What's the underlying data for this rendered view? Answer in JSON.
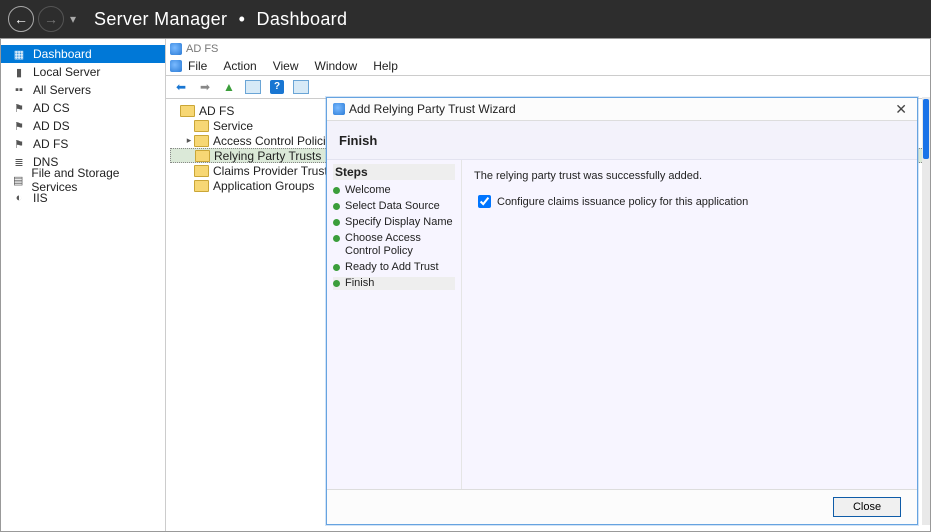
{
  "titlebar": {
    "app": "Server Manager",
    "crumb": "Dashboard"
  },
  "left_nav": [
    {
      "label": "Dashboard",
      "icon": "▦",
      "selected": true
    },
    {
      "label": "Local Server",
      "icon": "▮"
    },
    {
      "label": "All Servers",
      "icon": "▪▪"
    },
    {
      "label": "AD CS",
      "icon": "⚑"
    },
    {
      "label": "AD DS",
      "icon": "⚑"
    },
    {
      "label": "AD FS",
      "icon": "⚑"
    },
    {
      "label": "DNS",
      "icon": "≣"
    },
    {
      "label": "File and Storage Services",
      "icon": "▤"
    },
    {
      "label": "IIS",
      "icon": "◐"
    }
  ],
  "mmc": {
    "title": "AD FS",
    "menu": [
      "File",
      "Action",
      "View",
      "Window",
      "Help"
    ]
  },
  "tree": {
    "root": "AD FS",
    "children": [
      {
        "label": "Service"
      },
      {
        "label": "Access Control Policies"
      },
      {
        "label": "Relying Party Trusts",
        "selected": true
      },
      {
        "label": "Claims Provider Trusts"
      },
      {
        "label": "Application Groups"
      }
    ]
  },
  "wizard": {
    "title": "Add Relying Party Trust Wizard",
    "heading": "Finish",
    "steps_title": "Steps",
    "steps": [
      {
        "label": "Welcome"
      },
      {
        "label": "Select Data Source"
      },
      {
        "label": "Specify Display Name"
      },
      {
        "label": "Choose Access Control Policy"
      },
      {
        "label": "Ready to Add Trust"
      },
      {
        "label": "Finish",
        "active": true
      }
    ],
    "message": "The relying party trust was successfully added.",
    "checkbox_label": "Configure claims issuance policy for this application",
    "checkbox_checked": true,
    "close_button": "Close"
  }
}
